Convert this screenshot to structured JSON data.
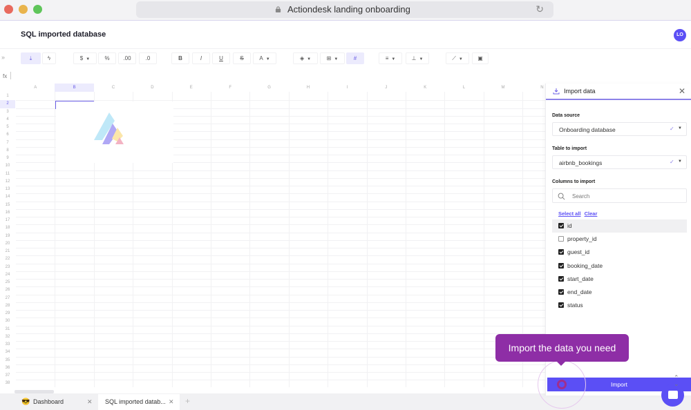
{
  "browser": {
    "url_title": "Actiondesk landing onboarding",
    "reload_icon": "reload-icon",
    "lock_icon": "lock-icon"
  },
  "header": {
    "title": "SQL imported database",
    "avatar_initials": "LO"
  },
  "toolbar": {
    "expand": "»",
    "buttons": [
      {
        "name": "import",
        "icon": "download-icon",
        "glyph": "⤓",
        "active": true
      },
      {
        "name": "actions",
        "icon": "lightning-icon",
        "glyph": "ϟ"
      },
      {
        "name": "currency",
        "icon": "currency-icon",
        "glyph": "$",
        "caret": true
      },
      {
        "name": "percent",
        "icon": "percent-icon",
        "glyph": "%"
      },
      {
        "name": "increase-decimals",
        "icon": "decimal-increase-icon",
        "glyph": ".00"
      },
      {
        "name": "decrease-decimals",
        "icon": "decimal-decrease-icon",
        "glyph": ".0"
      },
      {
        "name": "bold",
        "icon": "bold-icon",
        "glyph": "B"
      },
      {
        "name": "italic",
        "icon": "italic-icon",
        "glyph": "I"
      },
      {
        "name": "underline",
        "icon": "underline-icon",
        "glyph": "U"
      },
      {
        "name": "strikethrough",
        "icon": "strikethrough-icon",
        "glyph": "S"
      },
      {
        "name": "text-color",
        "icon": "text-color-icon",
        "glyph": "A",
        "caret": true
      },
      {
        "name": "fill-color",
        "icon": "fill-color-icon",
        "glyph": "◈",
        "caret": true
      },
      {
        "name": "borders",
        "icon": "borders-icon",
        "glyph": "⊞",
        "caret": true
      },
      {
        "name": "merge",
        "icon": "grid-icon",
        "glyph": "#",
        "active": true
      },
      {
        "name": "align",
        "icon": "align-icon",
        "glyph": "≡",
        "caret": true
      },
      {
        "name": "vertical-align",
        "icon": "vertical-align-icon",
        "glyph": "⊥",
        "caret": true
      },
      {
        "name": "chart",
        "icon": "chart-icon",
        "glyph": "⟋",
        "caret": true
      },
      {
        "name": "pivot",
        "icon": "pivot-icon",
        "glyph": "▣"
      }
    ]
  },
  "formula_bar": {
    "label": "fx",
    "value": ""
  },
  "grid": {
    "columns": [
      "A",
      "B",
      "C",
      "D",
      "E",
      "F",
      "G",
      "H",
      "I",
      "J",
      "K",
      "L",
      "M",
      "N"
    ],
    "selected_column": "B",
    "row_count": 38,
    "selected_row": 2
  },
  "sheet_tabs": [
    {
      "emoji": "😎",
      "label": "Dashboard",
      "active": false
    },
    {
      "label": "SQL imported datab...",
      "active": true
    }
  ],
  "sheet_add": "+",
  "import_panel": {
    "title": "Import data",
    "close": "✕",
    "data_source_label": "Data source",
    "data_source_value": "Onboarding database",
    "table_label": "Table to import",
    "table_value": "airbnb_bookings",
    "columns_label": "Columns to import",
    "search_placeholder": "Search",
    "select_all": "Select all",
    "clear": "Clear",
    "columns": [
      {
        "name": "id",
        "checked": true
      },
      {
        "name": "property_id",
        "checked": false
      },
      {
        "name": "guest_id",
        "checked": true
      },
      {
        "name": "booking_date",
        "checked": true
      },
      {
        "name": "start_date",
        "checked": true
      },
      {
        "name": "end_date",
        "checked": true
      },
      {
        "name": "status",
        "checked": true
      }
    ],
    "import_button": "Import",
    "check_glyph": "✓",
    "caret_glyph": "▼"
  },
  "onboarding_tooltip": "Import the data you need",
  "colors": {
    "accent": "#5b4ff5",
    "tooltip": "#8e2ea6",
    "selection_bg": "#ecebfd"
  }
}
